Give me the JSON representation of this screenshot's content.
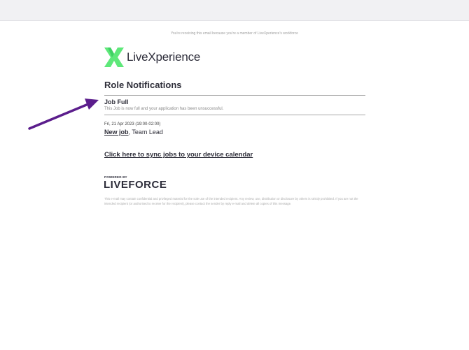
{
  "email": {
    "notice": "You're receiving this email because you're a member of LiveXperience's workforce",
    "brand_name": "LiveXperience",
    "brand_color": "#5ee87a",
    "section_title": "Role Notifications",
    "job_status": "Job Full",
    "job_status_description": "This Job is now full and your application has been unsuccessful.",
    "job_date": "Fri, 21 Apr 2023 (19:00-02:00)",
    "job_link": "New job",
    "job_separator": ",",
    "job_role": " Team Lead",
    "sync_link": "Click here to sync jobs to your device calendar",
    "powered_by": "POWERED BY",
    "powered_brand": "LIVEFORCE",
    "disclaimer": "This e-mail may contain confidential and privileged material for the sole use of the intended recipient. Any review, use, distribution or disclosure by others is strictly prohibited. If you are not the intended recipient (or authorised to receive for the recipient), please contact the sender by reply e-mail and delete all copies of this message."
  },
  "annotation": {
    "arrow_color": "#5b1d8c",
    "icon": "arrow-icon"
  }
}
